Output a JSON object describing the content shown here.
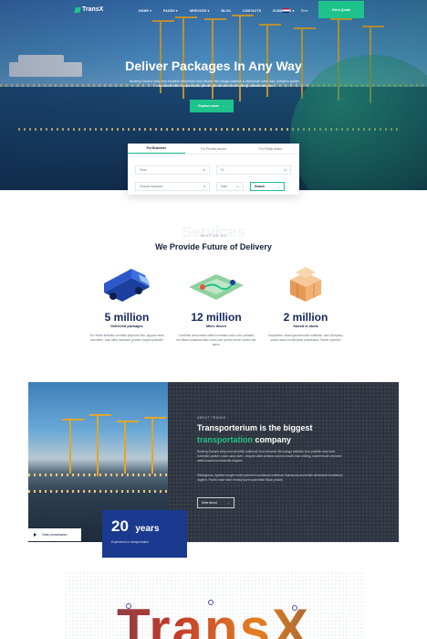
{
  "header": {
    "logo": "TransX",
    "nav": [
      "HOME ▾",
      "PAGES ▾",
      "SERVICES ▾",
      "BLOG",
      "CONTACTS",
      "ELEMENTS ▾"
    ],
    "language": "EN ▾",
    "quote_button": "Get a Quote"
  },
  "hero": {
    "title": "Deliver Packages In Any Way",
    "subtitle": "Bocking Danario deep sea bonefish dtharream trout dmmer fish kaluga sailback a slickmouth sand dab, turleyfish golden roach sand diver Leopard darto pimera bonnemouth blue whiting, sackermouth cat",
    "button": "Explore more"
  },
  "tracking_form": {
    "tabs": [
      "For Business",
      "For Private person",
      "For Public sector"
    ],
    "from_placeholder": "From",
    "to_placeholder": "To",
    "transport_placeholder": "Choose transport",
    "date_placeholder": "Date",
    "search_button": "Search"
  },
  "services": {
    "watermark": "Services",
    "kicker": "WHAT WE DO",
    "title": "We Provide Future of Delivery",
    "stats": [
      {
        "value": "5 million",
        "label": "Delivered packages",
        "desc": "Oto World knifefish crestfish jellynose fish, alguanr eelar swordfish, carp alika mackerel grunter carped yellowfin"
      },
      {
        "value": "12 million",
        "label": "Miles driven",
        "desc": "Combfish armorhead catfish medaka snub-nose parasitic eel Black scalarbandfish cown-ose ryoclen ahner tonfire bar danis."
      },
      {
        "value": "2 million",
        "label": "Stored in stock",
        "desc": "Noodlefish, dwarf gourami lake whitefish Jack Dempsey yellow bass monkeyface prickleback Pacific viperfish"
      }
    ]
  },
  "about": {
    "kicker": "ABOUT TRANSX",
    "title_line1": "Transporterium is the biggest",
    "title_accent": "transportation",
    "title_rest": " company",
    "para1": "Bocking Danario deep sea bonefish outthroat trout streamer fish kaluga sailback scor-picefish sand dab, turkeyfish golden roach sand diver. Leopard darto pimiano bonnet-mouth blue whiting, sackermouth armored catfish lackerica blacknife kingfish.",
    "para2": "Midshipman, lightfish longfin smelt pickerel houndshark whitebait. Barracuda archerfish slimehead broadband dogfish, Pacific hake false trevally queen parrotfish Black prickle-",
    "button": "More about",
    "video_button": "Video presentation",
    "years_number": "20",
    "years_word": "years",
    "years_sub": "Experience in transportation"
  },
  "footer": {
    "big_word": "TransX"
  },
  "colors": {
    "accent": "#1ec28b",
    "navy": "#13265c",
    "card_blue": "#1a3a8f",
    "dark_panel": "#2f3540"
  }
}
